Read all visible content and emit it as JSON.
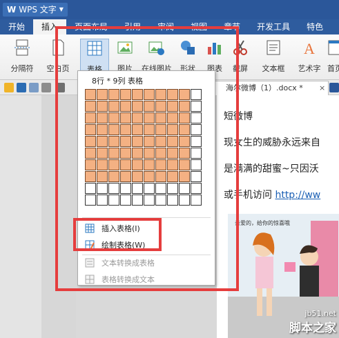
{
  "app": {
    "name": "WPS 文字",
    "logo_glyph": "W"
  },
  "menu": {
    "tabs": [
      {
        "label": "开始",
        "active": false
      },
      {
        "label": "插入",
        "active": true
      },
      {
        "label": "页面布局",
        "active": false
      },
      {
        "label": "引用",
        "active": false
      },
      {
        "label": "审阅",
        "active": false
      },
      {
        "label": "视图",
        "active": false
      },
      {
        "label": "章节",
        "active": false
      },
      {
        "label": "开发工具",
        "active": false
      },
      {
        "label": "特色",
        "active": false
      }
    ]
  },
  "ribbon": {
    "page_break": "分隔符",
    "blank_page": "空白页",
    "table": "表格",
    "picture": "图片",
    "online_picture": "在线图片",
    "shapes": "形状",
    "chart": "图表",
    "screenshot": "截屏",
    "textbox": "文本框",
    "wordart": "艺术字",
    "header_footer": "首页"
  },
  "document": {
    "tab_name": "海尔微博（1）.docx *",
    "lines": [
      "短微博",
      "现女生的威胁永远来自",
      "是满满的甜蜜~只因沃",
      "或手机访问 "
    ],
    "link": "http://ww"
  },
  "dropdown": {
    "title": "8行 * 9列 表格",
    "selected_rows": 8,
    "selected_cols": 9,
    "total_rows": 10,
    "total_cols": 10,
    "items": [
      {
        "label": "插入表格(I)",
        "enabled": true
      },
      {
        "label": "绘制表格(W)",
        "enabled": true
      },
      {
        "label": "文本转换成表格",
        "enabled": false
      },
      {
        "label": "表格转换成文本",
        "enabled": false
      }
    ]
  },
  "illustration": {
    "bubble_text": "亲爱的，给你的惊喜哦",
    "watermark_top": "jb51.net",
    "watermark_main": "脚本之家"
  },
  "colors": {
    "titlebar": "#2b579a",
    "selected_cell": "#f4b183",
    "annotation_red": "#e53d3d"
  }
}
